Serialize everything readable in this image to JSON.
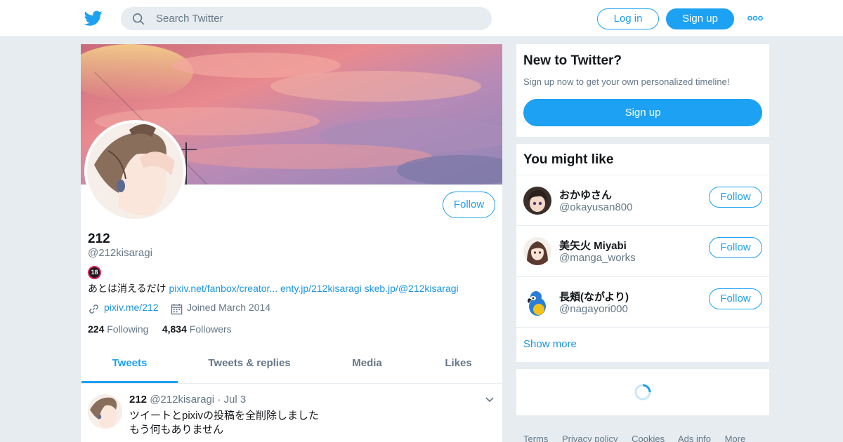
{
  "header": {
    "search_placeholder": "Search Twitter",
    "login_label": "Log in",
    "signup_label": "Sign up"
  },
  "profile": {
    "name": "212",
    "handle": "@212kisaragi",
    "badge": "18",
    "bio_text": "あとは消えるだけ",
    "bio_links": [
      "pixiv.net/fanbox/creator...",
      "enty.jp/212kisaragi",
      "skeb.jp/@212kisaragi"
    ],
    "website": "pixiv.me/212",
    "joined": "Joined March 2014",
    "following_count": "224",
    "following_label": "Following",
    "followers_count": "4,834",
    "followers_label": "Followers",
    "follow_label": "Follow"
  },
  "tabs": [
    "Tweets",
    "Tweets & replies",
    "Media",
    "Likes"
  ],
  "tweet": {
    "name": "212",
    "handle": "@212kisaragi",
    "sep": "·",
    "date": "Jul 3",
    "line1": "ツイートとpixivの投稿を全削除しました",
    "line2": "もう何もありません"
  },
  "new_to_twitter": {
    "title": "New to Twitter?",
    "subtitle": "Sign up now to get your own personalized timeline!",
    "button": "Sign up"
  },
  "you_might_like": {
    "title": "You might like",
    "users": [
      {
        "name": "おかゆさん",
        "handle": "@okayusan800",
        "follow": "Follow"
      },
      {
        "name": "美矢火 Miyabi",
        "handle": "@manga_works",
        "follow": "Follow"
      },
      {
        "name": "長頬(ながより)",
        "handle": "@nagayori000",
        "follow": "Follow"
      }
    ],
    "show_more": "Show more"
  },
  "footer": [
    "Terms",
    "Privacy policy",
    "Cookies",
    "Ads info",
    "More"
  ],
  "colors": {
    "accent": "#1da1f2",
    "link": "#1b95e0",
    "page_bg": "#e6ecf0",
    "muted_text": "#657786"
  },
  "icons": [
    "twitter-bird-icon",
    "search-icon",
    "more-dots-icon",
    "link-icon",
    "calendar-icon",
    "chevron-down-icon",
    "loading-spinner-icon"
  ]
}
